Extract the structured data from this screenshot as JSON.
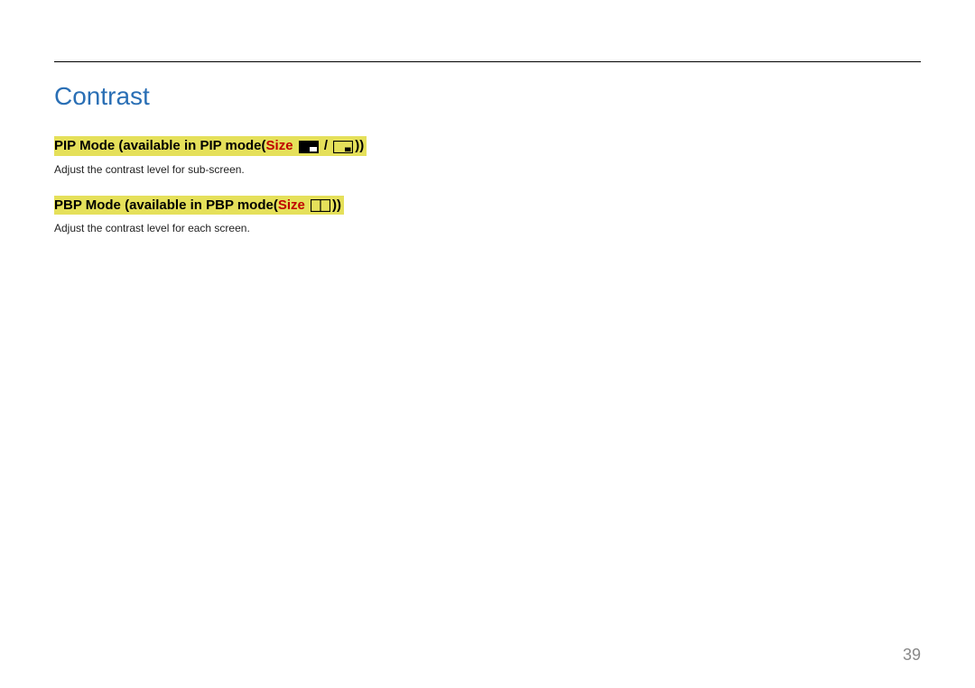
{
  "heading": "Contrast",
  "section1": {
    "prefix": "PIP Mode (available in PIP mode(",
    "sizeWord": "Size",
    "separator": " / ",
    "suffix": "))",
    "body": "Adjust the contrast level for sub-screen."
  },
  "section2": {
    "prefix": "PBP Mode (available in PBP mode(",
    "sizeWord": "Size",
    "suffix": "))",
    "body": "Adjust the contrast level for each screen."
  },
  "pageNumber": "39"
}
